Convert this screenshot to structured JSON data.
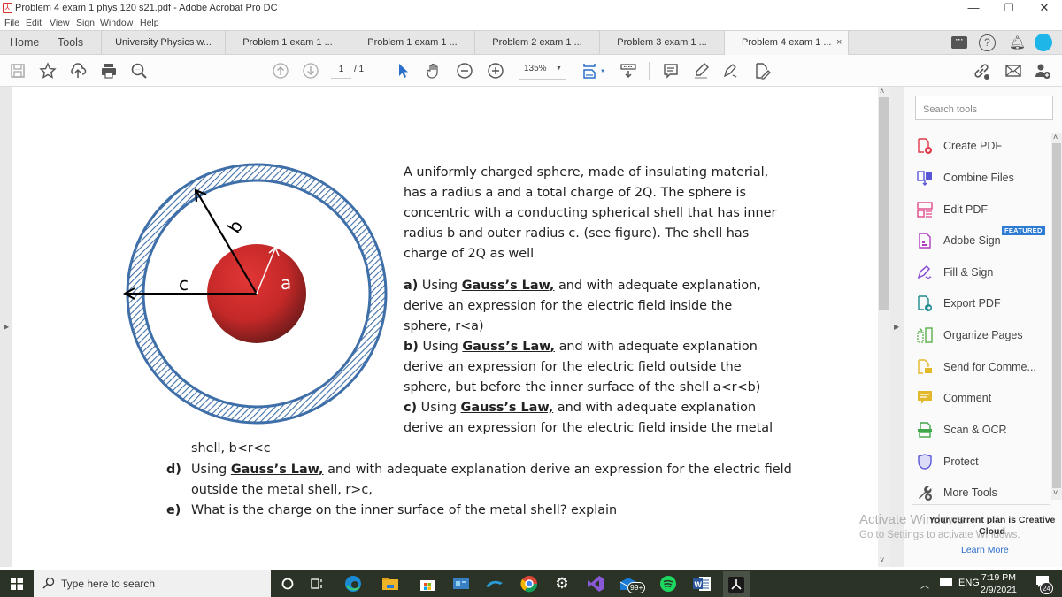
{
  "window": {
    "title": "Problem 4 exam  1 phys 120 s21.pdf - Adobe Acrobat Pro DC",
    "controls": {
      "minimize": "—",
      "maximize": "❐",
      "close": "✕"
    }
  },
  "menu": [
    "File",
    "Edit",
    "View",
    "Sign",
    "Window",
    "Help"
  ],
  "nav_tabs": [
    "Home",
    "Tools"
  ],
  "doc_tabs": [
    {
      "label": "University Physics w...",
      "active": false
    },
    {
      "label": "Problem 1 exam 1 ...",
      "active": false
    },
    {
      "label": "Problem 1 exam 1 ...",
      "active": false
    },
    {
      "label": "Problem 2 exam 1 ...",
      "active": false
    },
    {
      "label": "Problem 3 exam 1 ...",
      "active": false
    },
    {
      "label": "Problem 4 exam  1 ...",
      "active": true,
      "close": "×"
    }
  ],
  "toolbar": {
    "page_current": "1",
    "page_total": "/ 1",
    "zoom": "135%"
  },
  "document": {
    "intro": [
      "A uniformly charged sphere, made of insulating material,",
      "has a radius a and a total charge of 2Q. The sphere is",
      "concentric with a conducting spherical shell that has inner",
      "radius b and outer radius c. (see figure). The shell has",
      "charge of 2Q as well"
    ],
    "gauss": "Gauss’s Law,",
    "qa": {
      "label": "a)",
      "pre": " Using ",
      "post": " and with adequate explanation,",
      "l2": "derive an expression for the electric field inside the",
      "l3": "sphere, r<a)"
    },
    "qb": {
      "label": "b)",
      "pre": " Using ",
      "post": " and with adequate explanation",
      "l2": "derive an expression for the electric field outside the",
      "l3": "sphere, but before the inner surface of the shell a<r<b)"
    },
    "qc": {
      "label": "c)",
      "pre": " Using ",
      "post": " and with adequate explanation",
      "l2": "derive an expression for the electric field inside the metal",
      "l3": "shell,  b<r<c"
    },
    "qd": {
      "label": "d)",
      "pre": "Using ",
      "post": " and with adequate explanation derive an expression for the electric field",
      "l2": "outside the metal shell, r>c,"
    },
    "qe": {
      "label": "e)",
      "text": "What is the charge on the inner surface of the metal shell? explain"
    },
    "figure": {
      "label_a": "a",
      "label_b": "b",
      "label_c": "c",
      "shell_color": "#3f6fa8",
      "sphere_color": "#cc2a2a"
    }
  },
  "sidepanel": {
    "search_placeholder": "Search tools",
    "tools": [
      {
        "label": "Create PDF",
        "icon": "create-pdf-icon",
        "color": "#e0394a"
      },
      {
        "label": "Combine Files",
        "icon": "combine-files-icon",
        "color": "#5a56d6"
      },
      {
        "label": "Edit PDF",
        "icon": "edit-pdf-icon",
        "color": "#e0488a"
      },
      {
        "label": "Adobe Sign",
        "icon": "adobe-sign-icon",
        "color": "#b03dbf"
      },
      {
        "label": "Fill & Sign",
        "icon": "fill-sign-icon",
        "color": "#8a4fd6"
      },
      {
        "label": "Export PDF",
        "icon": "export-pdf-icon",
        "color": "#1f8a8f"
      },
      {
        "label": "Organize Pages",
        "icon": "organize-pages-icon",
        "color": "#5ab04a"
      },
      {
        "label": "Send for Comme...",
        "icon": "send-for-comment-icon",
        "color": "#e2b92a"
      },
      {
        "label": "Comment",
        "icon": "comment-icon",
        "color": "#e2b92a"
      },
      {
        "label": "Scan & OCR",
        "icon": "scan-ocr-icon",
        "color": "#3fa84a"
      },
      {
        "label": "Protect",
        "icon": "protect-icon",
        "color": "#5a56d6"
      },
      {
        "label": "More Tools",
        "icon": "more-tools-icon",
        "color": "#555555"
      }
    ],
    "featured_badge": "FEATURED",
    "plan_text": "Your current plan is Creative Cloud",
    "learn_more": "Learn More"
  },
  "watermark": {
    "line1": "Activate Windows",
    "line2": "Go to Settings to activate Windows."
  },
  "taskbar": {
    "search_placeholder": "Type here to search",
    "mail_badge": "99+",
    "language": "ENG",
    "time": "7:19 PM",
    "date": "2/9/2021",
    "notifications": "24"
  }
}
